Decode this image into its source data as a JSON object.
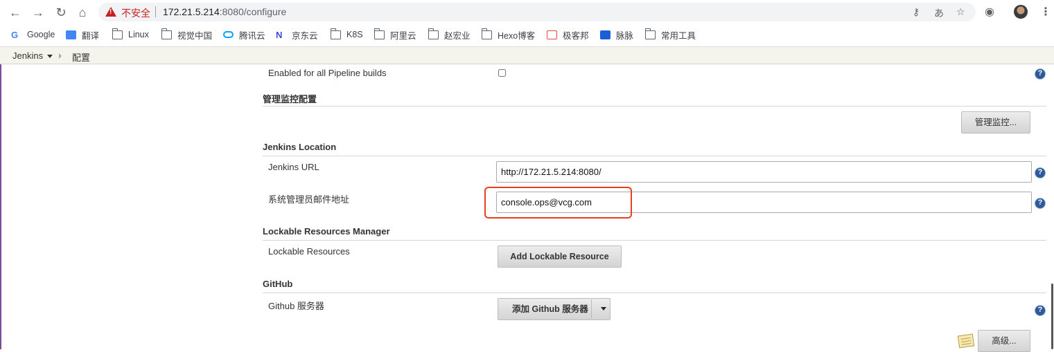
{
  "browser": {
    "insecure_label": "不安全",
    "url_host": "172.21.5.214",
    "url_rest": ":8080/configure",
    "bookmarks": [
      {
        "label": "Google"
      },
      {
        "label": "翻译"
      },
      {
        "label": "Linux"
      },
      {
        "label": "视觉中国"
      },
      {
        "label": "腾讯云"
      },
      {
        "label": "京东云"
      },
      {
        "label": "K8S"
      },
      {
        "label": "阿里云"
      },
      {
        "label": "赵宏业"
      },
      {
        "label": "Hexo博客"
      },
      {
        "label": "极客邦"
      },
      {
        "label": "脉脉"
      },
      {
        "label": "常用工具"
      }
    ]
  },
  "breadcrumb": {
    "root": "Jenkins",
    "current": "配置"
  },
  "form": {
    "pipeline_label": "Enabled for all Pipeline builds",
    "pipeline_checked": false,
    "monitor_section": "管理监控配置",
    "monitor_button": "管理监控...",
    "location_section": "Jenkins Location",
    "jenkins_url_label": "Jenkins URL",
    "jenkins_url_value": "http://172.21.5.214:8080/",
    "admin_email_label": "系统管理员邮件地址",
    "admin_email_value": "console.ops@vcg.com",
    "lockable_section": "Lockable Resources Manager",
    "lockable_label": "Lockable Resources",
    "lockable_button": "Add Lockable Resource",
    "github_section": "GitHub",
    "github_label": "Github 服务器",
    "github_button": "添加 Github 服务器",
    "advanced_button": "高级...",
    "help_symbol": "?"
  },
  "colors": {
    "highlight": "#e8401c",
    "accent": "#7a4b9a",
    "help": "#2d5a9a"
  }
}
